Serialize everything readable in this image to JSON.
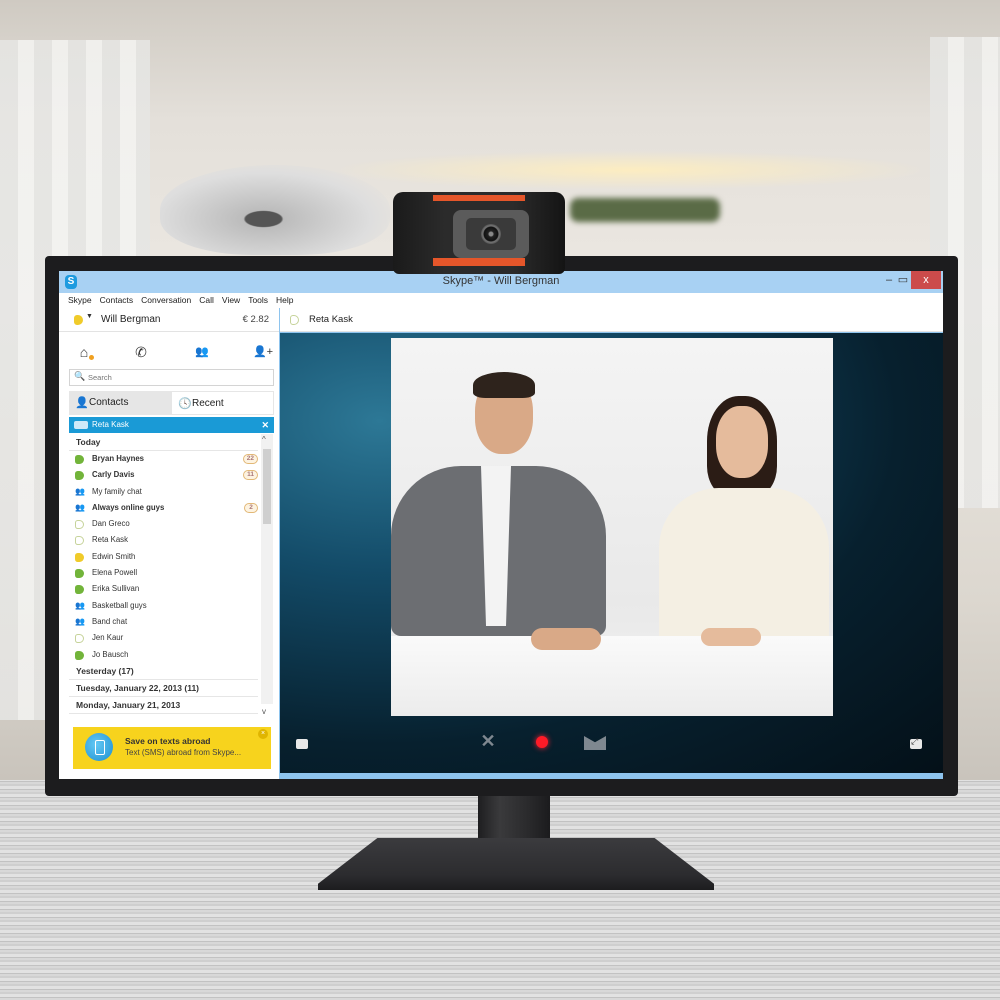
{
  "window": {
    "title": "Skype™ - Will Bergman",
    "logo_glyph": "S",
    "minimize_glyph": "–",
    "maximize_glyph": "▭",
    "close_glyph": "x"
  },
  "menu": [
    "Skype",
    "Contacts",
    "Conversation",
    "Call",
    "View",
    "Tools",
    "Help"
  ],
  "profile": {
    "name": "Will Bergman",
    "credit": "€ 2.82",
    "status": "away",
    "status_color": "#f0cb2a"
  },
  "actions": [
    {
      "name": "home-icon",
      "glyph": "⌂"
    },
    {
      "name": "phone-icon",
      "glyph": "✆"
    },
    {
      "name": "group-icon",
      "glyph": "👥"
    },
    {
      "name": "add-contact-icon",
      "glyph": "👤+"
    }
  ],
  "search": {
    "placeholder": "Search",
    "icon_glyph": "🔍"
  },
  "tabs": {
    "contacts": {
      "label": "Contacts",
      "glyph": "👤"
    },
    "recent": {
      "label": "Recent",
      "glyph": "🕓"
    }
  },
  "active_conversation": {
    "label": "Reta Kask",
    "close_glyph": "✕",
    "accent": "#1a9ad6"
  },
  "recent_list": {
    "today_label": "Today",
    "items": [
      {
        "name": "Bryan Haynes",
        "status": "online",
        "bold": true,
        "badge": "22"
      },
      {
        "name": "Carly Davis",
        "status": "online",
        "bold": true,
        "badge": "11"
      },
      {
        "name": "My family chat",
        "status": "group",
        "bold": false,
        "badge": ""
      },
      {
        "name": "Always online guys",
        "status": "group",
        "bold": true,
        "badge": "2"
      },
      {
        "name": "Dan Greco",
        "status": "offline",
        "bold": false,
        "badge": ""
      },
      {
        "name": "Reta Kask",
        "status": "offline",
        "bold": false,
        "badge": ""
      },
      {
        "name": "Edwin Smith",
        "status": "away",
        "bold": false,
        "badge": ""
      },
      {
        "name": "Elena Powell",
        "status": "online",
        "bold": false,
        "badge": ""
      },
      {
        "name": "Erika Sullivan",
        "status": "online",
        "bold": false,
        "badge": ""
      },
      {
        "name": "Basketball guys",
        "status": "group",
        "bold": false,
        "badge": ""
      },
      {
        "name": "Band chat",
        "status": "group",
        "bold": false,
        "badge": ""
      },
      {
        "name": "Jen Kaur",
        "status": "offline",
        "bold": false,
        "badge": ""
      },
      {
        "name": "Jo Bausch",
        "status": "online",
        "bold": false,
        "badge": ""
      }
    ],
    "older_groups": [
      "Yesterday (17)",
      "Tuesday, January 22, 2013 (11)",
      "Monday, January 21, 2013"
    ]
  },
  "promo": {
    "title": "Save on texts abroad",
    "subtitle": "Text (SMS) abroad from Skype...",
    "close_glyph": "×",
    "color": "#f7d31d"
  },
  "conversation": {
    "contact_name": "Reta Kask",
    "contact_status": "offline"
  },
  "call_controls": {
    "end_glyph": "✕",
    "record_color": "#ff1b27"
  }
}
